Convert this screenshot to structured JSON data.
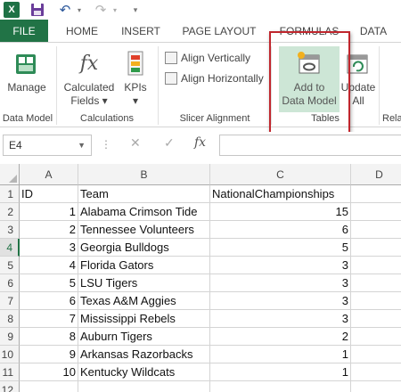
{
  "qat": {
    "app_icon": "excel-icon",
    "app_letter": "X",
    "undo_glyph": "↶",
    "redo_glyph": "↷",
    "dropdown_glyph": "▾",
    "customize_glyph": "▾"
  },
  "tabs": [
    {
      "label": "FILE"
    },
    {
      "label": "HOME"
    },
    {
      "label": "INSERT"
    },
    {
      "label": "PAGE LAYOUT"
    },
    {
      "label": "FORMULAS"
    },
    {
      "label": "DATA"
    }
  ],
  "ribbon": {
    "manage": "Manage",
    "data_model_group": "Data Model",
    "calculated_fields_1": "Calculated",
    "calculated_fields_2": "Fields ▾",
    "kpis": "KPIs",
    "kpis_dd": "▾",
    "calculations_group": "Calculations",
    "align_vertically": "Align Vertically",
    "align_horizontally": "Align Horizontally",
    "slicer_alignment_group": "Slicer Alignment",
    "add_to_1": "Add to",
    "add_to_2": "Data Model",
    "update_1": "Update",
    "update_2": "All",
    "tables_group": "Tables",
    "next_group_partial": "Rela"
  },
  "formula_bar": {
    "name_box": "E4",
    "cancel_glyph": "✕",
    "enter_glyph": "✓",
    "fx": "fx"
  },
  "sheet": {
    "columns": [
      "A",
      "B",
      "C",
      "D"
    ],
    "rows": [
      "1",
      "2",
      "3",
      "4",
      "5",
      "6",
      "7",
      "8",
      "9",
      "10",
      "11",
      "12"
    ],
    "header": {
      "id": "ID",
      "team": "Team",
      "champ": "NationalChampionships"
    },
    "data": [
      {
        "id": "1",
        "team": "Alabama Crimson Tide",
        "champ": "15"
      },
      {
        "id": "2",
        "team": "Tennessee Volunteers",
        "champ": "6"
      },
      {
        "id": "3",
        "team": "Georgia Bulldogs",
        "champ": "5"
      },
      {
        "id": "4",
        "team": "Florida Gators",
        "champ": "3"
      },
      {
        "id": "5",
        "team": "LSU Tigers",
        "champ": "3"
      },
      {
        "id": "6",
        "team": "Texas A&M Aggies",
        "champ": "3"
      },
      {
        "id": "7",
        "team": "Mississippi Rebels",
        "champ": "3"
      },
      {
        "id": "8",
        "team": "Auburn Tigers",
        "champ": "2"
      },
      {
        "id": "9",
        "team": "Arkansas Razorbacks",
        "champ": "1"
      },
      {
        "id": "10",
        "team": "Kentucky Wildcats",
        "champ": "1"
      }
    ]
  },
  "colors": {
    "excel_green": "#217346",
    "highlight_red": "#c0262d",
    "button_highlight": "#cde6d6"
  }
}
